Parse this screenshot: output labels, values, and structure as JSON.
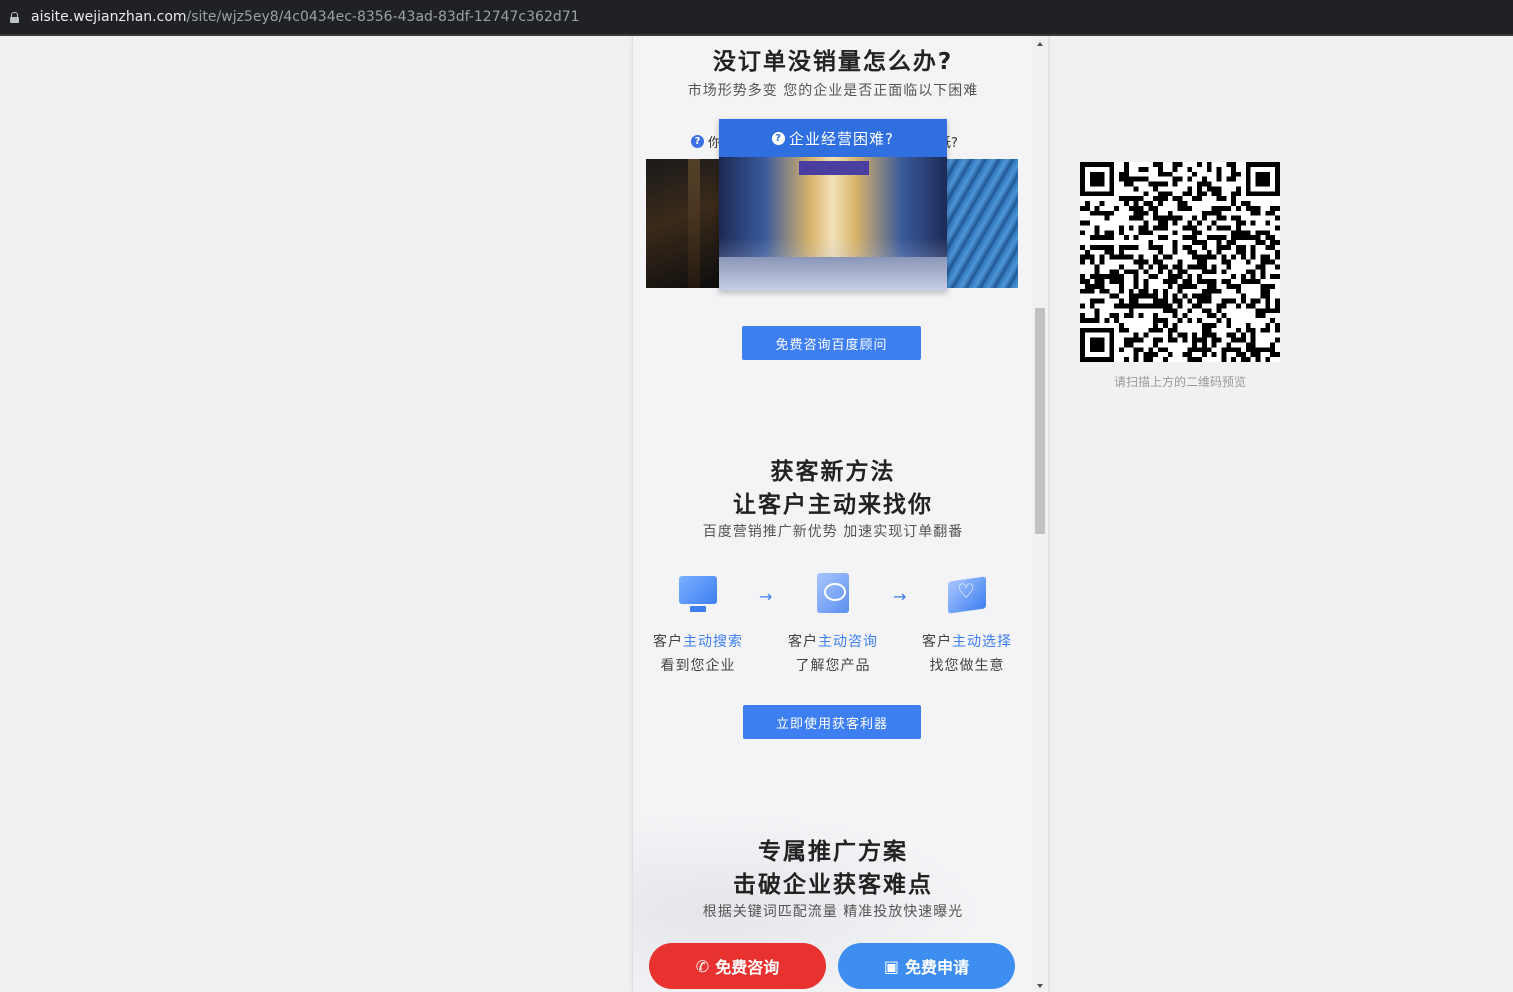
{
  "browser": {
    "url_host": "aisite.wejianzhan.com",
    "url_path": "/site/wjz5ey8/4c0434ec-8356-43ad-83df-12747c362d71"
  },
  "section1": {
    "title": "没订单没销量怎么办?",
    "subtitle": "市场形势多变 您的企业是否正面临以下困难",
    "left_question": "你",
    "right_question": "低?",
    "card_title": "企业经营困难?",
    "cta": "免费咨询百度顾问"
  },
  "section2": {
    "title_line1": "获客新方法",
    "title_line2": "让客户主动来找你",
    "subtitle": "百度营销推广新优势 加速实现订单翻番",
    "steps": [
      {
        "pre": "客户",
        "highlight": "主动搜索",
        "line2": "看到您企业",
        "icon": "monitor-icon"
      },
      {
        "pre": "客户",
        "highlight": "主动咨询",
        "line2": "了解您产品",
        "icon": "chat-icon"
      },
      {
        "pre": "客户",
        "highlight": "主动选择",
        "line2": "找您做生意",
        "icon": "heart-icon"
      }
    ],
    "cta": "立即使用获客利器"
  },
  "section3": {
    "title_line1": "专属推广方案",
    "title_line2": "击破企业获客难点",
    "subtitle": "根据关键词匹配流量 精准投放快速曝光"
  },
  "floating": {
    "consult": "免费咨询",
    "apply": "免费申请"
  },
  "qr": {
    "caption": "请扫描上方的二维码预览"
  },
  "colors": {
    "accent": "#3d7ff0",
    "red": "#e8322f"
  }
}
